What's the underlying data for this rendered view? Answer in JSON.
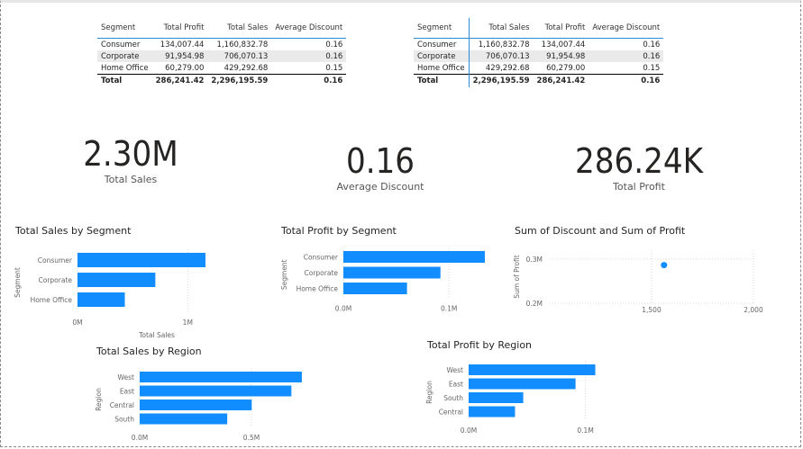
{
  "tables": [
    {
      "columns": [
        "Segment",
        "Total Profit",
        "Total Sales",
        "Average Discount"
      ],
      "rows": [
        [
          "Consumer",
          "134,007.44",
          "1,160,832.78",
          "0.16"
        ],
        [
          "Corporate",
          "91,954.98",
          "706,070.13",
          "0.16"
        ],
        [
          "Home Office",
          "60,279.00",
          "429,292.68",
          "0.15"
        ]
      ],
      "total": [
        "Total",
        "286,241.42",
        "2,296,195.59",
        "0.16"
      ]
    },
    {
      "columns": [
        "Segment",
        "Total Sales",
        "Total Profit",
        "Average Discount"
      ],
      "rows": [
        [
          "Consumer",
          "1,160,832.78",
          "134,007.44",
          "0.16"
        ],
        [
          "Corporate",
          "706,070.13",
          "91,954.98",
          "0.16"
        ],
        [
          "Home Office",
          "429,292.68",
          "60,279.00",
          "0.15"
        ]
      ],
      "total": [
        "Total",
        "2,296,195.59",
        "286,241.42",
        "0.16"
      ]
    }
  ],
  "cards": [
    {
      "value": "2.30M",
      "label": "Total Sales"
    },
    {
      "value": "0.16",
      "label": "Average Discount"
    },
    {
      "value": "286.24K",
      "label": "Total Profit"
    }
  ],
  "bar_color": "#118dff",
  "chart_data": [
    {
      "type": "bar",
      "title": "Total Sales by Segment",
      "xlabel": "Total Sales",
      "ylabel": "Segment",
      "categories": [
        "Consumer",
        "Corporate",
        "Home Office"
      ],
      "values": [
        1160832.78,
        706070.13,
        429292.68
      ],
      "xlim": [
        0,
        1300000
      ],
      "ticks": [
        0,
        1000000
      ],
      "tick_labels": [
        "0M",
        "1M"
      ]
    },
    {
      "type": "bar",
      "title": "Total Profit by Segment",
      "xlabel": "",
      "ylabel": "Segment",
      "categories": [
        "Consumer",
        "Corporate",
        "Home Office"
      ],
      "values": [
        134007.44,
        91954.98,
        60279.0
      ],
      "xlim": [
        0,
        140000
      ],
      "ticks": [
        0,
        100000
      ],
      "tick_labels": [
        "0.0M",
        "0.1M"
      ]
    },
    {
      "type": "scatter",
      "title": "Sum of Discount and Sum of Profit",
      "xlabel": "",
      "ylabel": "Sum of Profit",
      "x": [
        1561
      ],
      "y": [
        286241.42
      ],
      "xlim": [
        1000,
        2000
      ],
      "ylim": [
        200000,
        320000
      ],
      "xticks": [
        1500,
        2000
      ],
      "xtick_labels": [
        "1,500",
        "2,000"
      ],
      "yticks": [
        300000,
        200000
      ],
      "ytick_labels": [
        "0.3M",
        "0.2M"
      ]
    },
    {
      "type": "bar",
      "title": "Total Sales by Region",
      "xlabel": "",
      "ylabel": "Region",
      "categories": [
        "West",
        "East",
        "Central",
        "South"
      ],
      "values": [
        725457.82,
        678781.24,
        501239.89,
        391721.91
      ],
      "xlim": [
        0,
        750000
      ],
      "ticks": [
        0,
        500000
      ],
      "tick_labels": [
        "0.0M",
        "0.5M"
      ]
    },
    {
      "type": "bar",
      "title": "Total Profit by Region",
      "xlabel": "",
      "ylabel": "Region",
      "categories": [
        "West",
        "East",
        "South",
        "Central"
      ],
      "values": [
        108418.45,
        91522.78,
        46749.43,
        39706.36
      ],
      "xlim": [
        0,
        125000
      ],
      "ticks": [
        0,
        100000
      ],
      "tick_labels": [
        "0.0M",
        "0.1M"
      ]
    }
  ]
}
